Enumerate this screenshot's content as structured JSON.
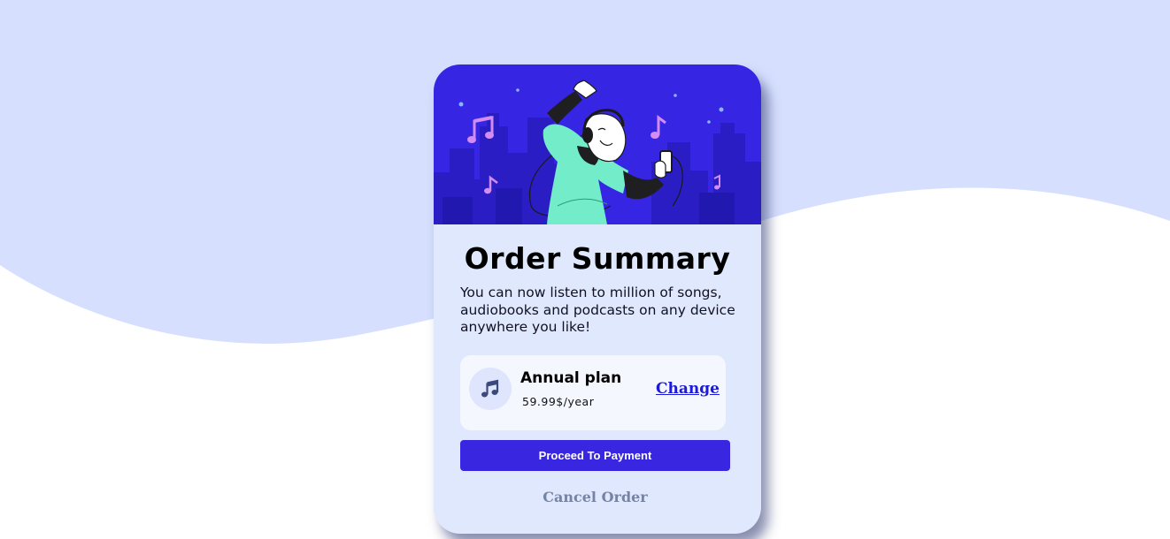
{
  "colors": {
    "page_background": "#ffffff",
    "wave": "#d6e0fe",
    "card_background": "#e0e8fe",
    "hero_background": "#3626e4",
    "plan_box": "#f5f7ff",
    "accent": "#3826e0",
    "link": "#1c1ad8",
    "muted": "#7584a5"
  },
  "hero": {
    "illustration": "person-dancing-with-headphones-illustration"
  },
  "summary": {
    "title": "Order Summary",
    "description": "You can now listen to million of songs, audiobooks and podcasts on any device anywhere you like!"
  },
  "plan": {
    "icon": "music-note-icon",
    "name": "Annual plan",
    "price": "59.99$/year",
    "change_label": "Change"
  },
  "actions": {
    "proceed_label": "Proceed To Payment",
    "cancel_label": "Cancel Order"
  }
}
